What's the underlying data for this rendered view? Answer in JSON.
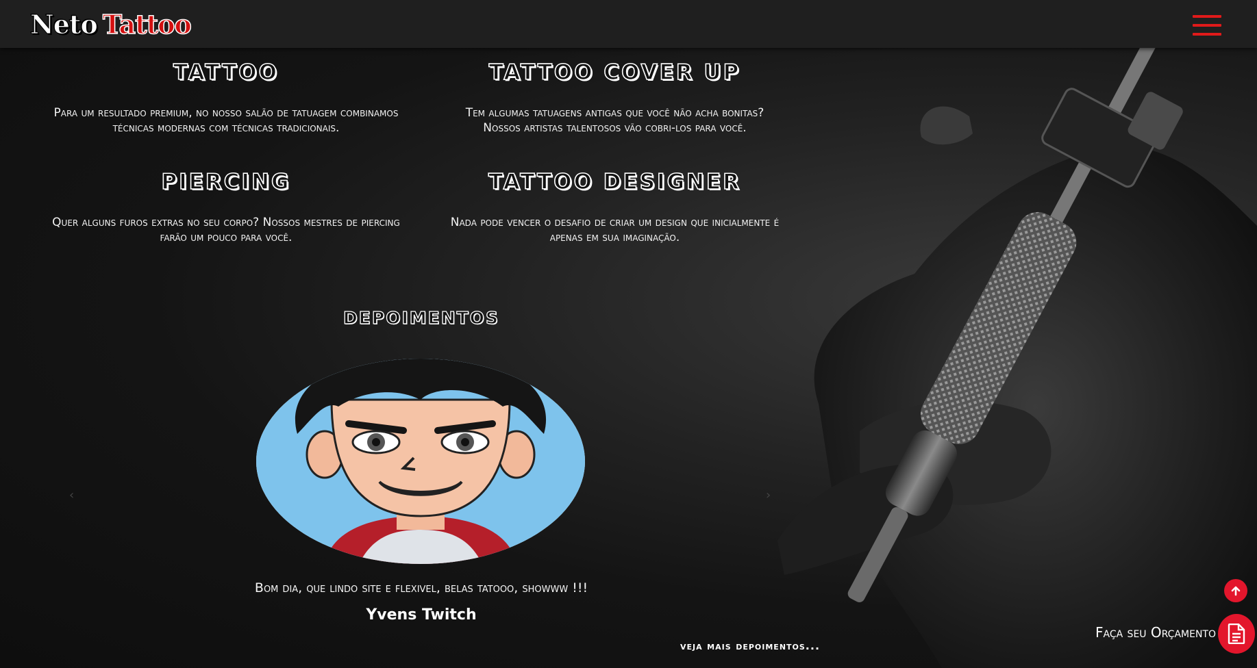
{
  "brand": {
    "word1": "Neto",
    "word2": "Tattoo"
  },
  "services": [
    {
      "title": "TATTOO",
      "text": "Para um resultado premium, no nosso salão de tatuagem combinamos técnicas modernas com técnicas tradicionais."
    },
    {
      "title": "TATTOO COVER UP",
      "text": "Tem algumas tatuagens antigas que você não acha bonitas? Nossos artistas talentosos vão cobri-los para você."
    },
    {
      "title": "PIERCING",
      "text": "Quer alguns furos extras no seu corpo? Nossos mestres de piercing farão um pouco para você."
    },
    {
      "title": "TATTOO DESIGNER",
      "text": "Nada pode vencer o desafio de criar um design que inicialmente é apenas em sua imaginação."
    }
  ],
  "testimonials": {
    "title": "DEPOIMENTOS",
    "quote": "Bom dia, que lindo site e flexivel, belas tatooo, showww !!!",
    "author": "Yvens Twitch",
    "prev_icon": "‹",
    "next_icon": "›",
    "more_link": "veja mais depoimentos..."
  },
  "floating": {
    "quote_label": "Faça seu Orçamento"
  },
  "icons": {
    "menu": "hamburger-icon",
    "scroll_top": "arrow-up-icon",
    "quote": "document-icon"
  },
  "colors": {
    "accent": "#e3162c",
    "header": "#1f1f1f"
  }
}
